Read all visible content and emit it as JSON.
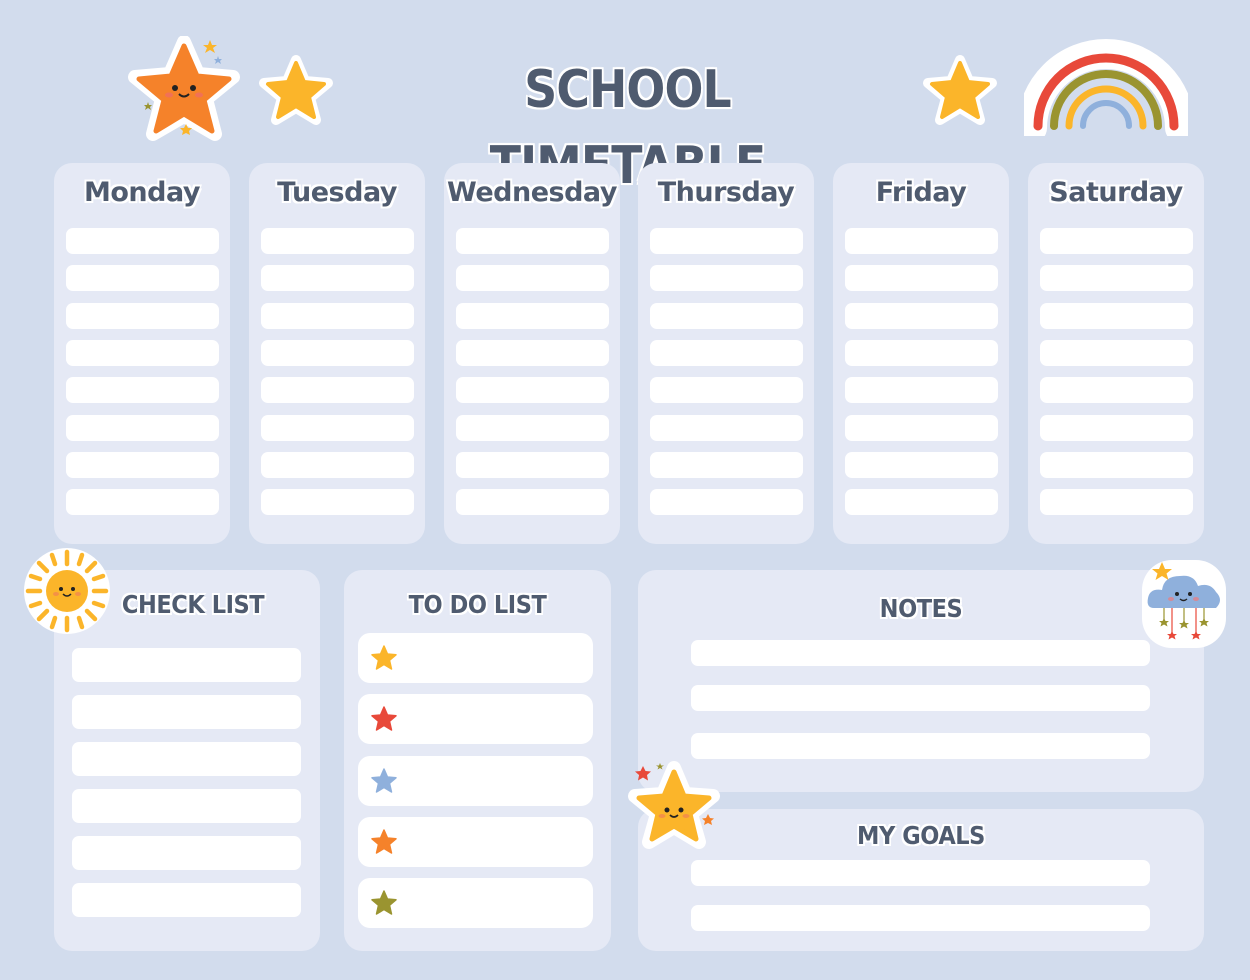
{
  "header": {
    "title": "SCHOOL TIMETABLE"
  },
  "days": [
    {
      "name": "Monday",
      "slots": 8
    },
    {
      "name": "Tuesday",
      "slots": 8
    },
    {
      "name": "Wednesday",
      "slots": 8
    },
    {
      "name": "Thursday",
      "slots": 8
    },
    {
      "name": "Friday",
      "slots": 8
    },
    {
      "name": "Saturday",
      "slots": 8
    }
  ],
  "checklist": {
    "title": "CHECK LIST",
    "items": [
      "",
      "",
      "",
      "",
      "",
      ""
    ]
  },
  "todo": {
    "title": "TO DO LIST",
    "items": [
      {
        "text": "",
        "star_color": "#fbb52a"
      },
      {
        "text": "",
        "star_color": "#e8493a"
      },
      {
        "text": "",
        "star_color": "#8fb0dc"
      },
      {
        "text": "",
        "star_color": "#f5822a"
      },
      {
        "text": "",
        "star_color": "#9a9430"
      }
    ]
  },
  "notes": {
    "title": "NOTES",
    "lines": [
      "",
      "",
      ""
    ]
  },
  "goals": {
    "title": "MY GOALS",
    "lines": [
      "",
      ""
    ]
  },
  "colors": {
    "background": "#d2dced",
    "panel": "#e5e9f5",
    "text": "#4f5b6f",
    "star_yellow": "#fbb52a",
    "star_orange": "#f5822a",
    "rainbow_red": "#e8493a",
    "rainbow_olive": "#9a9430",
    "rainbow_yellow": "#fbb52a",
    "rainbow_blue": "#8fb0dc"
  },
  "icons": [
    "orange-star-face-icon",
    "yellow-star-icon",
    "rainbow-icon",
    "sun-face-icon",
    "cloud-face-icon",
    "yellow-star-face-icon"
  ]
}
